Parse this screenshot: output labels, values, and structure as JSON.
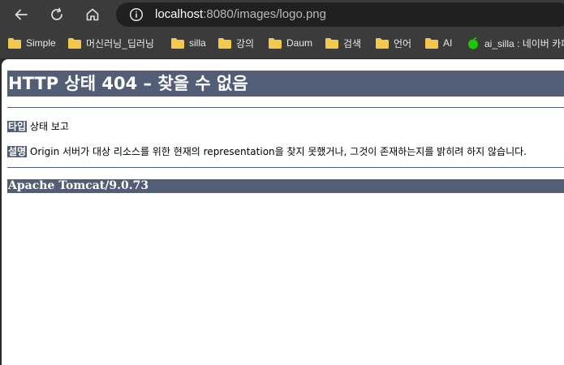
{
  "browser": {
    "url_host": "localhost",
    "url_rest": ":8080/images/logo.png",
    "bookmarks": [
      {
        "label": "Simple",
        "icon": "folder-icon"
      },
      {
        "label": "머신러닝_딥러닝",
        "icon": "folder-icon"
      },
      {
        "label": "silla",
        "icon": "folder-icon"
      },
      {
        "label": "강의",
        "icon": "folder-icon"
      },
      {
        "label": "Daum",
        "icon": "folder-icon"
      },
      {
        "label": "검색",
        "icon": "folder-icon"
      },
      {
        "label": "언어",
        "icon": "folder-icon"
      },
      {
        "label": "AI",
        "icon": "folder-icon"
      },
      {
        "label": "ai_silla : 네이버 카페",
        "icon": "naver-cafe-icon"
      }
    ]
  },
  "page": {
    "title": "HTTP 상태 404 – 찾을 수 없음",
    "type_label": "타입",
    "type_value": "상태 보고",
    "desc_label": "설명",
    "desc_value": "Origin 서버가 대상 리소스를 위한 현재의 representation을 찾지 못했거나, 그것이 존재하는지를 밝히려 하지 않습니다.",
    "footer": "Apache Tomcat/9.0.73"
  },
  "colors": {
    "tomcat_header": "#525d76",
    "chrome_bg": "#3b3b3b",
    "omnibox_bg": "#202020",
    "folder": "#f2c94c"
  }
}
